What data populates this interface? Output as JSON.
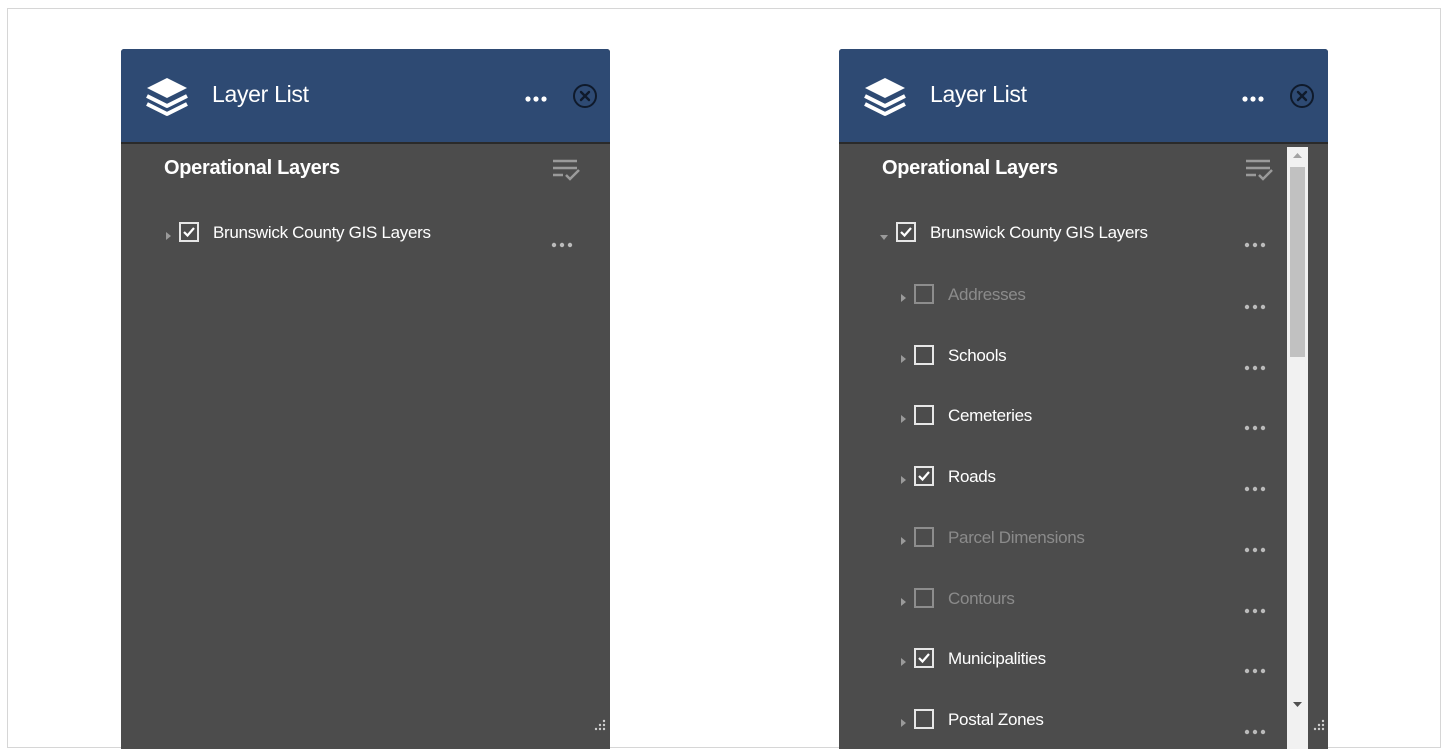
{
  "panel_left": {
    "title": "Layer List",
    "icons": {
      "header": "layers-icon",
      "more": "more-horizontal-icon",
      "close": "close-circle-icon",
      "filter": "filter-list-icon",
      "resize": "resize-grip-icon"
    },
    "section_title": "Operational Layers",
    "layers": [
      {
        "label": "Brunswick County GIS Layers",
        "checked": true,
        "expanded": false,
        "dimmed": false
      }
    ]
  },
  "panel_right": {
    "title": "Layer List",
    "section_title": "Operational Layers",
    "root_layer": {
      "label": "Brunswick County GIS Layers",
      "checked": true,
      "expanded": true
    },
    "sublayers": [
      {
        "label": "Addresses",
        "checked": false,
        "dimmed": true
      },
      {
        "label": "Schools",
        "checked": false,
        "dimmed": false
      },
      {
        "label": "Cemeteries",
        "checked": false,
        "dimmed": false
      },
      {
        "label": "Roads",
        "checked": true,
        "dimmed": false
      },
      {
        "label": "Parcel Dimensions",
        "checked": false,
        "dimmed": true
      },
      {
        "label": "Contours",
        "checked": false,
        "dimmed": true
      },
      {
        "label": "Municipalities",
        "checked": true,
        "dimmed": false
      },
      {
        "label": "Postal Zones",
        "checked": false,
        "dimmed": false
      }
    ]
  },
  "colors": {
    "header_bg": "#2e4a73",
    "panel_bg": "#4c4c4c",
    "text": "#ffffff",
    "dim_text": "#8b8b8b"
  }
}
